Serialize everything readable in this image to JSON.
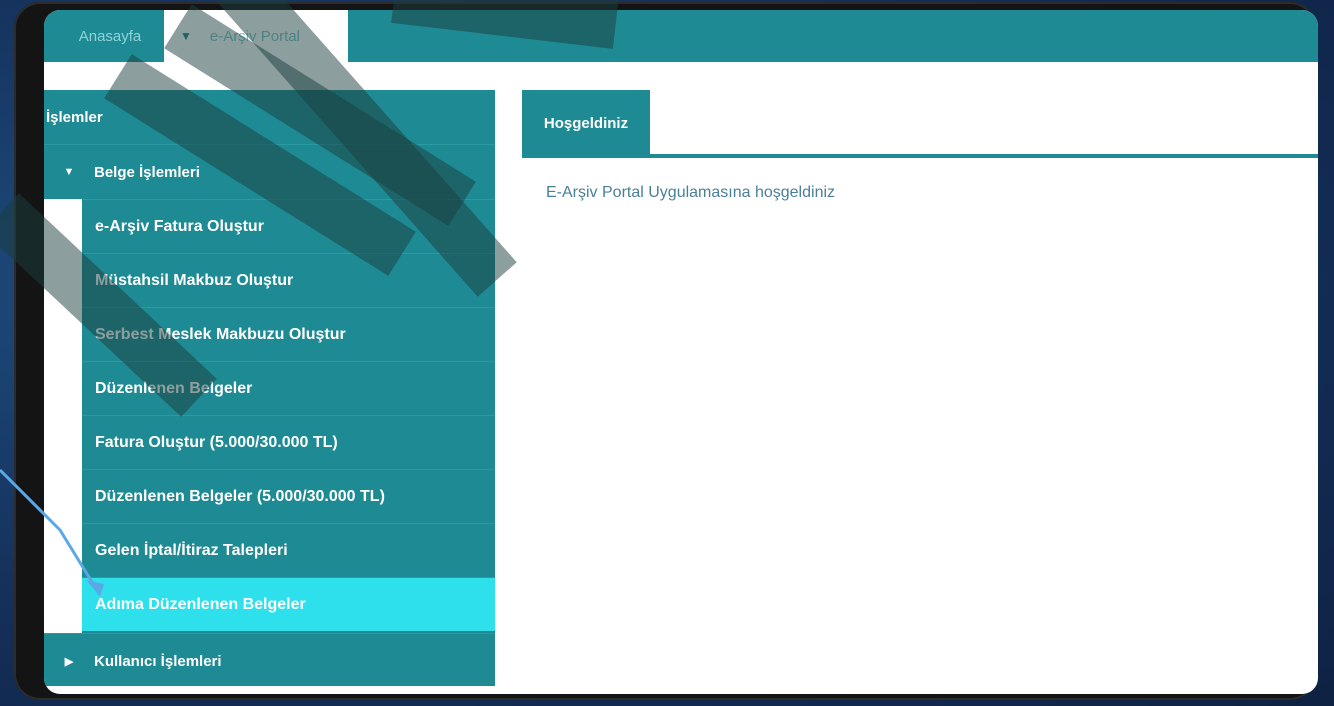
{
  "topbar": {
    "home_tab": "Anasayfa",
    "portal_tab": "e-Arşiv Portal",
    "caret_icon": "caret-down-icon"
  },
  "sidebar": {
    "header": "İşlemler",
    "groups": [
      {
        "label": "Belge İşlemleri",
        "expanded": true,
        "items": [
          {
            "label": "e-Arşiv Fatura Oluştur"
          },
          {
            "label": "Müstahsil Makbuz Oluştur"
          },
          {
            "label": "Serbest Meslek Makbuzu Oluştur"
          },
          {
            "label": "Düzenlenen Belgeler"
          },
          {
            "label": "Fatura Oluştur (5.000/30.000 TL)"
          },
          {
            "label": "Düzenlenen Belgeler (5.000/30.000 TL)"
          },
          {
            "label": "Gelen İptal/İtiraz Talepleri"
          },
          {
            "label": "Adıma Düzenlenen Belgeler",
            "active": true
          }
        ]
      },
      {
        "label": "Kullanıcı İşlemleri",
        "expanded": false
      }
    ]
  },
  "main": {
    "tab": "Hoşgeldiniz",
    "welcome_text": "E-Arşiv Portal Uygulamasına hoşgeldiniz"
  },
  "colors": {
    "teal": "#1e8a93",
    "active": "#2ee0ec",
    "background": "#15305a"
  }
}
